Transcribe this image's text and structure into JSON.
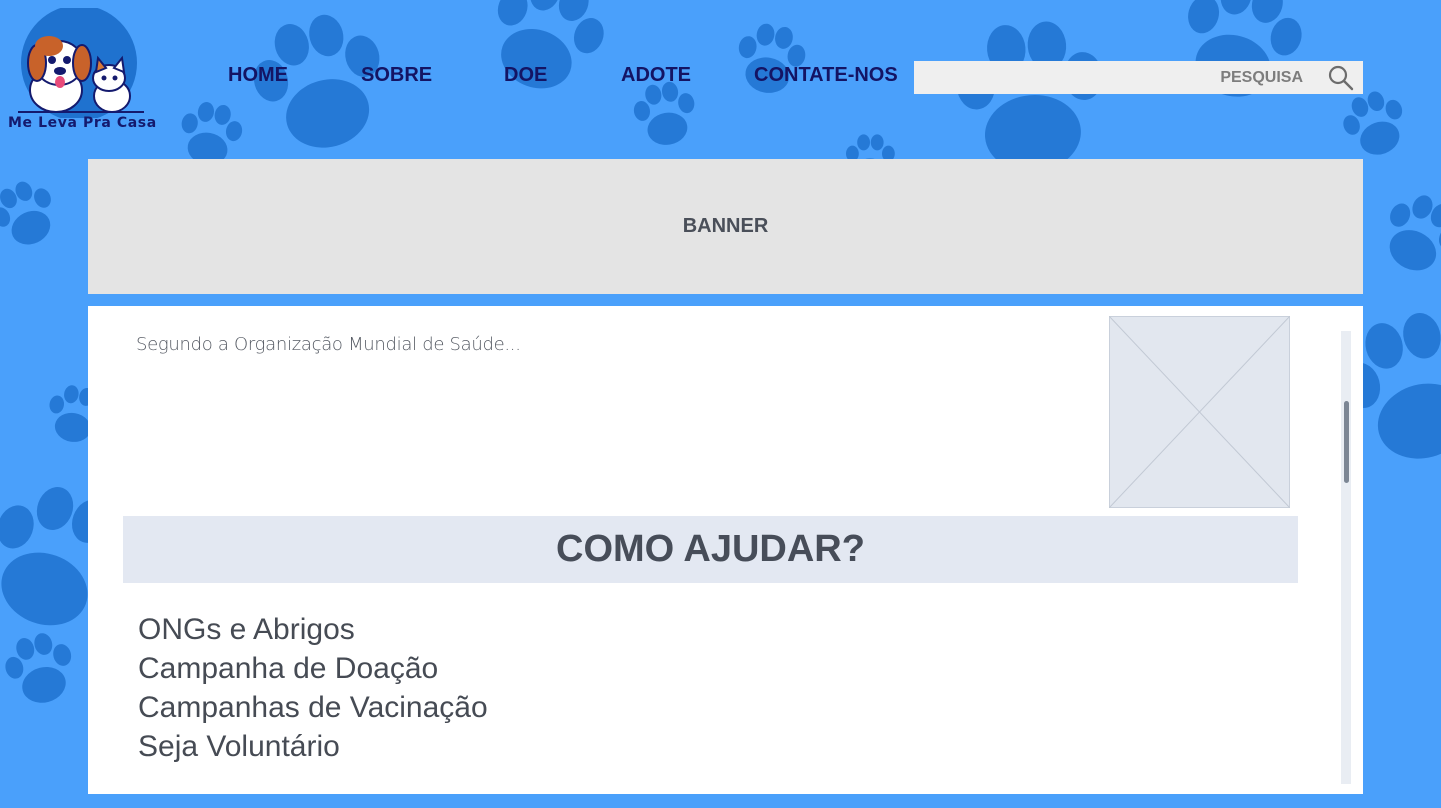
{
  "app": {
    "name": "Me Leva Pra Casa"
  },
  "nav": {
    "items": [
      {
        "label": "HOME"
      },
      {
        "label": "SOBRE"
      },
      {
        "label": "DOE"
      },
      {
        "label": "ADOTE"
      },
      {
        "label": "CONTATE-NOS"
      }
    ]
  },
  "search": {
    "placeholder": "PESQUISA",
    "icon": "search-icon"
  },
  "banner": {
    "label": "BANNER"
  },
  "content": {
    "intro_text": "Segundo a Organização Mundial de Saúde...",
    "image_placeholder": "image-placeholder-icon",
    "section_title": "COMO AJUDAR?",
    "help_items": [
      {
        "label": "ONGs e Abrigos"
      },
      {
        "label": "Campanha de Doação"
      },
      {
        "label": "Campanhas de Vacinação"
      },
      {
        "label": "Seja Voluntário"
      }
    ]
  },
  "colors": {
    "background": "#4aa0fb",
    "paw": "#1f72cf",
    "nav_text": "#141464",
    "banner_bg": "#e4e4e4",
    "section_header_bg": "#e3e8f2"
  }
}
